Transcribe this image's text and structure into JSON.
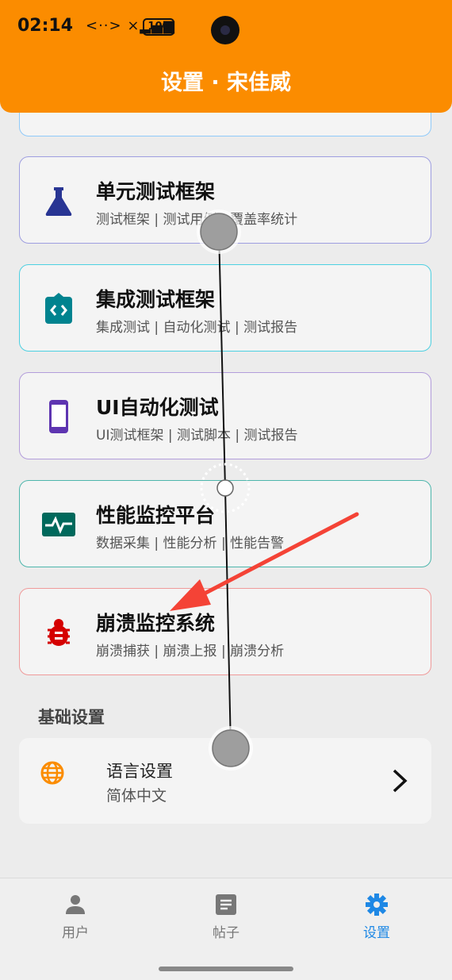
{
  "status_bar": {
    "time": "02:14",
    "signal": "<··> ×▂▄▆",
    "battery": "100"
  },
  "header": {
    "title": "设置 · 宋佳威"
  },
  "cards": [
    {
      "title": "单元测试框架",
      "subtitle": "测试框架 | 测试用例 | 覆盖率统计",
      "border_color": "#9e9ee0",
      "icon_color": "#283593"
    },
    {
      "title": "集成测试框架",
      "subtitle": "集成测试 | 自动化测试 | 测试报告",
      "border_color": "#4dd0e1",
      "icon_color": "#00838f"
    },
    {
      "title": "UI自动化测试",
      "subtitle": "UI测试框架 | 测试脚本 | 测试报告",
      "border_color": "#b39ddb",
      "icon_color": "#5e35b1"
    },
    {
      "title": "性能监控平台",
      "subtitle": "数据采集 | 性能分析 | 性能告警",
      "border_color": "#4db6ac",
      "icon_color": "#00695c"
    },
    {
      "title": "崩溃监控系统",
      "subtitle": "崩溃捕获 | 崩溃上报 | 崩溃分析",
      "border_color": "#ef9a9a",
      "icon_color": "#d50000"
    }
  ],
  "section": {
    "basic_settings": "基础设置"
  },
  "language": {
    "title": "语言设置",
    "value": "简体中文",
    "icon_color": "#fb8c00"
  },
  "bottom_nav": [
    {
      "label": "用户",
      "icon": "person-icon",
      "active": false
    },
    {
      "label": "帖子",
      "icon": "article-icon",
      "active": false
    },
    {
      "label": "设置",
      "icon": "gear-icon",
      "active": true
    }
  ],
  "colors": {
    "accent": "#fb8c00",
    "active_nav": "#1e88e5",
    "arrow": "#f44336"
  }
}
